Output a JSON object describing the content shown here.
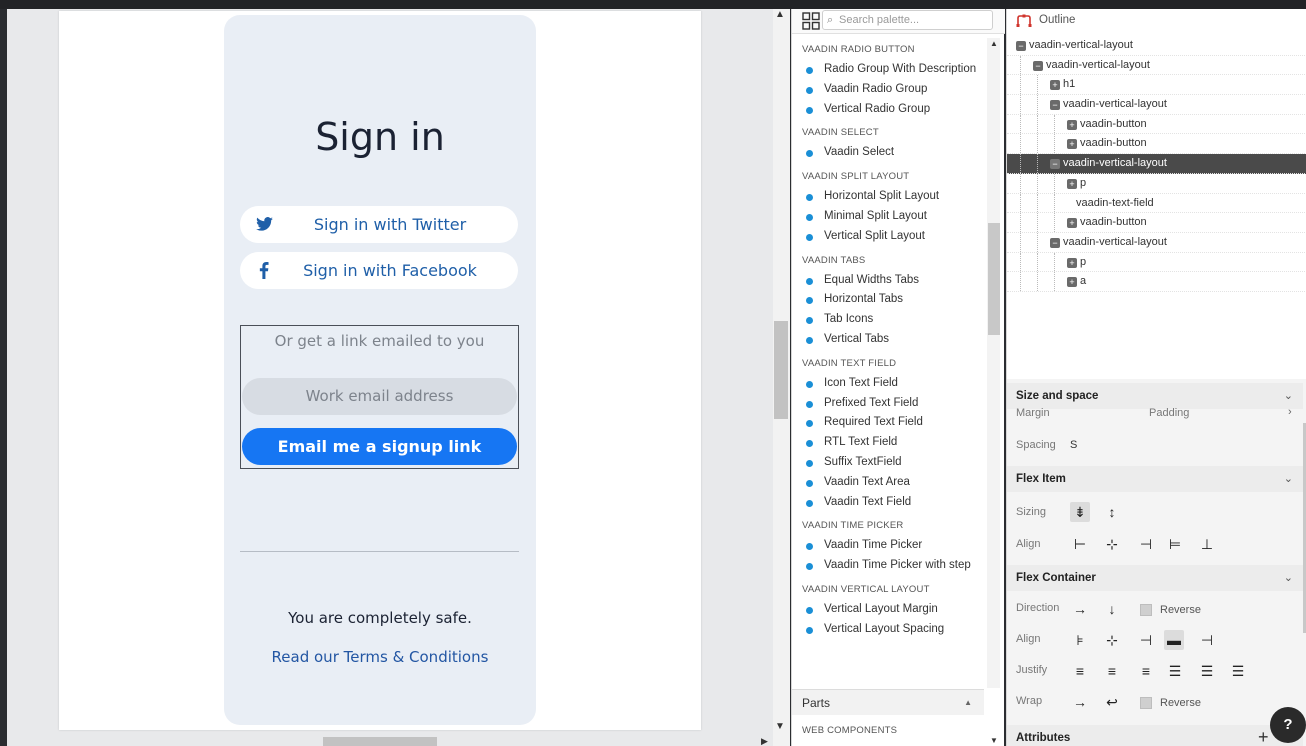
{
  "preview": {
    "title": "Sign in",
    "twitter_label": "Sign in with Twitter",
    "facebook_label": "Sign in with Facebook",
    "email_hint": "Or get a link emailed to you",
    "email_placeholder": "Work email address",
    "send_label": "Email me a signup link",
    "safe_text": "You are completely safe.",
    "terms_link": "Read our Terms & Conditions"
  },
  "palette": {
    "search_placeholder": "Search palette...",
    "sections": [
      {
        "title": "VAADIN RADIO BUTTON",
        "items": [
          "Radio Group With Description",
          "Vaadin Radio Group",
          "Vertical Radio Group"
        ]
      },
      {
        "title": "VAADIN SELECT",
        "items": [
          "Vaadin Select"
        ]
      },
      {
        "title": "VAADIN SPLIT LAYOUT",
        "items": [
          "Horizontal Split Layout",
          "Minimal Split Layout",
          "Vertical Split Layout"
        ]
      },
      {
        "title": "VAADIN TABS",
        "items": [
          "Equal Widths Tabs",
          "Horizontal Tabs",
          "Tab Icons",
          "Vertical Tabs"
        ]
      },
      {
        "title": "VAADIN TEXT FIELD",
        "items": [
          "Icon Text Field",
          "Prefixed Text Field",
          "Required Text Field",
          "RTL Text Field",
          "Suffix TextField",
          "Vaadin Text Area",
          "Vaadin Text Field"
        ]
      },
      {
        "title": "VAADIN TIME PICKER",
        "items": [
          "Vaadin Time Picker",
          "Vaadin Time Picker with step"
        ]
      },
      {
        "title": "VAADIN VERTICAL LAYOUT",
        "items": [
          "Vertical Layout Margin",
          "Vertical Layout Spacing"
        ]
      }
    ],
    "parts_label": "Parts",
    "web_components_label": "WEB COMPONENTS"
  },
  "outline": {
    "title": "Outline",
    "nodes": [
      {
        "label": "vaadin-vertical-layout",
        "depth": 0,
        "toggle": "minus"
      },
      {
        "label": "vaadin-vertical-layout",
        "depth": 1,
        "toggle": "minus"
      },
      {
        "label": "h1",
        "depth": 2,
        "toggle": "plus"
      },
      {
        "label": "vaadin-vertical-layout",
        "depth": 2,
        "toggle": "minus"
      },
      {
        "label": "vaadin-button",
        "depth": 3,
        "toggle": "plus"
      },
      {
        "label": "vaadin-button",
        "depth": 3,
        "toggle": "plus"
      },
      {
        "label": "vaadin-vertical-layout",
        "depth": 2,
        "toggle": "minus",
        "selected": true
      },
      {
        "label": "p",
        "depth": 3,
        "toggle": "plus"
      },
      {
        "label": "vaadin-text-field",
        "depth": 3,
        "toggle": "none"
      },
      {
        "label": "vaadin-button",
        "depth": 3,
        "toggle": "plus"
      },
      {
        "label": "vaadin-vertical-layout",
        "depth": 2,
        "toggle": "minus"
      },
      {
        "label": "p",
        "depth": 3,
        "toggle": "plus"
      },
      {
        "label": "a",
        "depth": 3,
        "toggle": "plus"
      }
    ]
  },
  "properties": {
    "size_space": {
      "title": "Size and space",
      "margin": "Margin",
      "padding": "Padding",
      "spacing": "Spacing",
      "spacing_value": "S"
    },
    "flex_item": {
      "title": "Flex Item",
      "sizing": "Sizing",
      "align": "Align"
    },
    "flex_container": {
      "title": "Flex Container",
      "direction": "Direction",
      "reverse": "Reverse",
      "align": "Align",
      "justify": "Justify",
      "wrap": "Wrap",
      "wrap_reverse": "Reverse"
    },
    "attributes": "Attributes"
  },
  "help": "?",
  "colors": {
    "accent": "#1676f3",
    "dot": "#1a8fd6",
    "selected_row": "#4a4a4a"
  }
}
